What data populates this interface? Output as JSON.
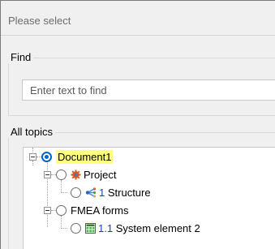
{
  "dialog": {
    "title": "Please select"
  },
  "find": {
    "label": "Find",
    "placeholder": "Enter text to find",
    "value": ""
  },
  "topics": {
    "label": "All topics",
    "tree": {
      "root": {
        "label": "Document1",
        "selected": true,
        "children": {
          "project": {
            "label": "Project",
            "icon": "gear-icon",
            "child": {
              "number": "1",
              "label": " Structure",
              "icon": "structure-icon"
            }
          },
          "fmea": {
            "label": "FMEA forms",
            "child": {
              "number": "1.1",
              "label": " System element 2",
              "icon": "table-grid-icon"
            }
          }
        }
      }
    }
  },
  "colors": {
    "selection_highlight": "#ffff80",
    "radio_accent": "#0063c6",
    "number_text": "#1a3fc0"
  }
}
